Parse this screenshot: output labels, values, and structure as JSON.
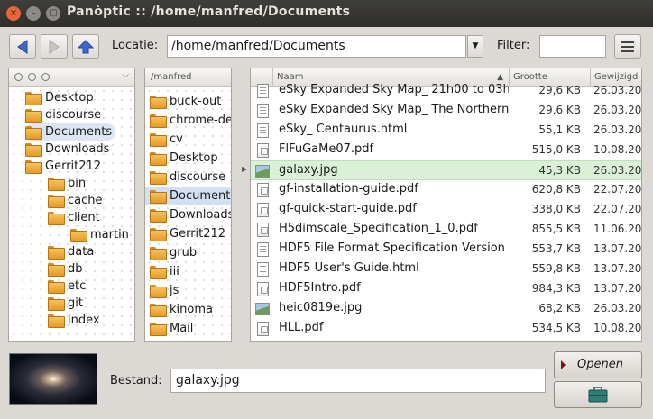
{
  "window": {
    "title": "Panòptic  ::  /home/manfred/Documents",
    "controls": [
      "×",
      "–",
      "▢"
    ]
  },
  "toolbar": {
    "location_label": "Locatie:",
    "location_value": "/home/manfred/Documents",
    "filter_label": "Filter:",
    "filter_value": ""
  },
  "tree": {
    "items": [
      {
        "label": "Desktop"
      },
      {
        "label": "discourse"
      },
      {
        "label": "Documents"
      },
      {
        "label": "Downloads"
      },
      {
        "label": "Gerrit212"
      },
      {
        "label": "bin"
      },
      {
        "label": "cache"
      },
      {
        "label": "client"
      },
      {
        "label": "martin"
      },
      {
        "label": "data"
      },
      {
        "label": "db"
      },
      {
        "label": "etc"
      },
      {
        "label": "git"
      },
      {
        "label": "index"
      }
    ]
  },
  "column2": {
    "header": "/manfred",
    "items": [
      {
        "label": "buck-out"
      },
      {
        "label": "chrome-de"
      },
      {
        "label": "cv"
      },
      {
        "label": "Desktop"
      },
      {
        "label": "discourse"
      },
      {
        "label": "Documents"
      },
      {
        "label": "Downloads"
      },
      {
        "label": "Gerrit212"
      },
      {
        "label": "grub"
      },
      {
        "label": "iii"
      },
      {
        "label": "js"
      },
      {
        "label": "kinoma"
      },
      {
        "label": "Mail"
      }
    ]
  },
  "files": {
    "columns": [
      "Naam",
      "Grootte",
      "Gewijzigd"
    ],
    "rows": [
      {
        "name": "eSky Expanded Sky Map_ 21h00 to 03h",
        "size": "29,6 KB",
        "date": "26.03.20",
        "type": "doc"
      },
      {
        "name": "eSky Expanded Sky Map_ The Northern",
        "size": "29,6 KB",
        "date": "26.03.20",
        "type": "doc"
      },
      {
        "name": "eSky_ Centaurus.html",
        "size": "55,1 KB",
        "date": "26.03.20",
        "type": "doc"
      },
      {
        "name": "FlFuGaMe07.pdf",
        "size": "515,0 KB",
        "date": "10.08.20",
        "type": "pdf"
      },
      {
        "name": "galaxy.jpg",
        "size": "45,3 KB",
        "date": "26.03.20",
        "type": "img"
      },
      {
        "name": "gf-installation-guide.pdf",
        "size": "620,8 KB",
        "date": "22.07.20",
        "type": "pdf"
      },
      {
        "name": "gf-quick-start-guide.pdf",
        "size": "338,0 KB",
        "date": "22.07.20",
        "type": "pdf"
      },
      {
        "name": "H5dimscale_Specification_1_0.pdf",
        "size": "855,5 KB",
        "date": "11.06.20",
        "type": "pdf"
      },
      {
        "name": "HDF5 File Format Specification Version",
        "size": "553,7 KB",
        "date": "13.07.20",
        "type": "doc"
      },
      {
        "name": "HDF5 User's Guide.html",
        "size": "559,8 KB",
        "date": "13.07.20",
        "type": "doc"
      },
      {
        "name": "HDF5Intro.pdf",
        "size": "984,3 KB",
        "date": "13.07.20",
        "type": "pdf"
      },
      {
        "name": "heic0819e.jpg",
        "size": "68,2 KB",
        "date": "26.03.20",
        "type": "img"
      },
      {
        "name": "HLL.pdf",
        "size": "534,5 KB",
        "date": "10.08.20",
        "type": "pdf"
      }
    ]
  },
  "bottom": {
    "file_label": "Bestand:",
    "file_value": "galaxy.jpg",
    "open_label": "Openen"
  }
}
